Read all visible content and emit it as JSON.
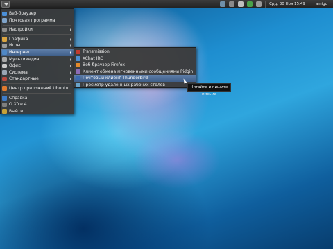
{
  "panel": {
    "date_time": "Срд, 30 Ноя  15:49",
    "user": "amigo",
    "tray_icons": [
      "network-icon",
      "music-icon",
      "volume-icon",
      "battery-icon",
      "notification-icon"
    ]
  },
  "menu": {
    "items": [
      {
        "label": "Веб-браузер",
        "icon": "browser-icon",
        "color": "#4a8fd8"
      },
      {
        "label": "Почтовая программа",
        "icon": "mail-icon",
        "color": "#7fa3c9"
      },
      {
        "label": "Настройки",
        "icon": "settings-icon",
        "color": "#8c8c8c",
        "submenu": true
      },
      {
        "label": "Графика",
        "icon": "graphics-icon",
        "color": "#d9a441",
        "submenu": true
      },
      {
        "label": "Игры",
        "icon": "games-icon",
        "color": "#9a9a9a",
        "submenu": true
      },
      {
        "label": "Интернет",
        "icon": "internet-icon",
        "color": "#4f88c6",
        "submenu": true
      },
      {
        "label": "Мультимедиа",
        "icon": "multimedia-icon",
        "color": "#a8a8a8",
        "submenu": true
      },
      {
        "label": "Офис",
        "icon": "office-icon",
        "color": "#c9c9c9",
        "submenu": true
      },
      {
        "label": "Система",
        "icon": "system-icon",
        "color": "#9aa6b4",
        "submenu": true
      },
      {
        "label": "Стандартные",
        "icon": "accessories-icon",
        "color": "#b94a3f",
        "submenu": true
      },
      {
        "label": "Центр приложений Ubuntu",
        "icon": "software-center-icon",
        "color": "#e07a2f"
      },
      {
        "label": "Справка",
        "icon": "help-icon",
        "color": "#3e7cc8"
      },
      {
        "label": "О Xfce 4",
        "icon": "about-icon",
        "color": "#7f7f7f"
      },
      {
        "label": "Выйти",
        "icon": "logout-icon",
        "color": "#c6a23a"
      }
    ]
  },
  "submenu": {
    "items": [
      {
        "label": "Transmission",
        "icon": "transmission-icon",
        "color": "#c23b2e"
      },
      {
        "label": "XChat IRC",
        "icon": "xchat-icon",
        "color": "#4c8ed0"
      },
      {
        "label": "Веб-браузер Firefox",
        "icon": "firefox-icon",
        "color": "#e48a2a"
      },
      {
        "label": "Клиент обмена мгновенными сообщениями Pidgin",
        "icon": "pidgin-icon",
        "color": "#8c6bb5"
      },
      {
        "label": "Почтовый клиент Thunderbird",
        "icon": "thunderbird-icon",
        "color": "#3b6ab0"
      },
      {
        "label": "Просмотр удалённых рабочих столов",
        "icon": "remote-desktop-icon",
        "color": "#6aa3c9"
      }
    ]
  },
  "tooltip": "Читайте и пишите письма",
  "colors": {
    "highlight": "#4f6f98",
    "menu_bg": "#3a3a3a",
    "panel_bg": "#2b2b2b"
  }
}
